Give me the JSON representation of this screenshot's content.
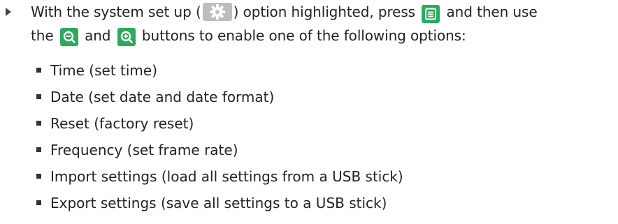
{
  "instruction": {
    "line1": {
      "before_gear": "With the system set up (",
      "after_gear": ") option highlighted, press",
      "after_menu": "and then use"
    },
    "line2": {
      "start": "the",
      "middle": "and",
      "end": "buttons to enable one of the following options:"
    }
  },
  "icons": {
    "gear": "gear-icon",
    "menu": "menu-icon",
    "zoom_out": "zoom-out-icon",
    "zoom_in": "zoom-in-icon",
    "accent_green": "#2eaa5c",
    "gear_background": "#bdbdbd"
  },
  "options": [
    "Time (set time)",
    "Date (set date and date format)",
    "Reset (factory reset)",
    "Frequency (set frame rate)",
    "Import settings (load all settings from a USB stick)",
    "Export settings (save all settings to a USB stick)"
  ]
}
